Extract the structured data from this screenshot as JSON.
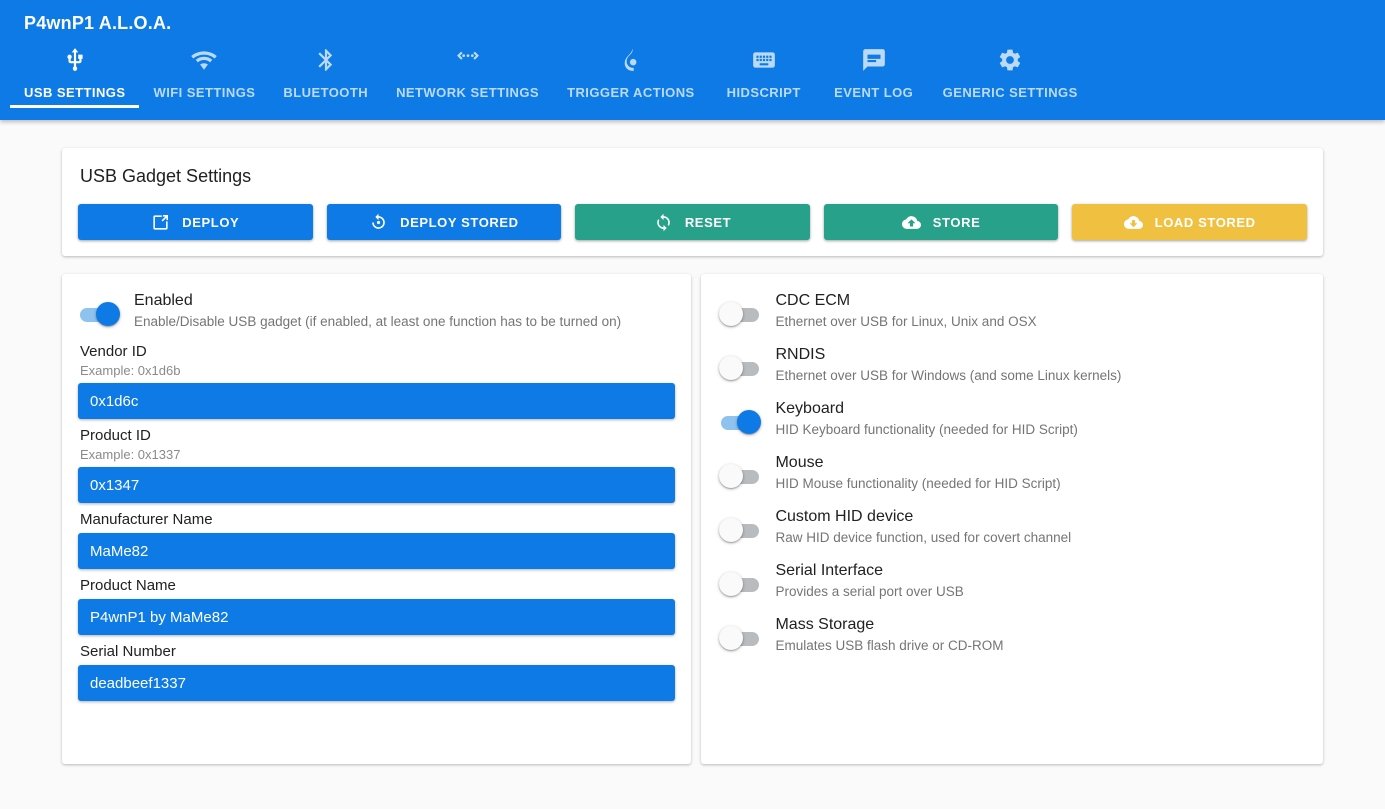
{
  "app": {
    "title": "P4wnP1 A.L.O.A.",
    "header_color": "#0d7ae5"
  },
  "tabs": [
    {
      "label": "USB SETTINGS",
      "icon": "usb-icon",
      "active": true
    },
    {
      "label": "WIFI SETTINGS",
      "icon": "wifi-icon",
      "active": false
    },
    {
      "label": "BLUETOOTH",
      "icon": "bluetooth-icon",
      "active": false
    },
    {
      "label": "NETWORK SETTINGS",
      "icon": "network-icon",
      "active": false
    },
    {
      "label": "TRIGGER ACTIONS",
      "icon": "flame-icon",
      "active": false
    },
    {
      "label": "HIDSCRIPT",
      "icon": "keyboard-icon",
      "active": false
    },
    {
      "label": "EVENT LOG",
      "icon": "event-log-icon",
      "active": false
    },
    {
      "label": "GENERIC SETTINGS",
      "icon": "gear-icon",
      "active": false
    }
  ],
  "usb_gadget": {
    "title": "USB Gadget Settings",
    "buttons": [
      {
        "label": "DEPLOY",
        "icon": "open-in-new-icon",
        "color": "#0d7ae5"
      },
      {
        "label": "DEPLOY STORED",
        "icon": "restore-icon",
        "color": "#0d7ae5"
      },
      {
        "label": "RESET",
        "icon": "sync-icon",
        "color": "#28a18a"
      },
      {
        "label": "STORE",
        "icon": "cloud-upload-icon",
        "color": "#28a18a"
      },
      {
        "label": "LOAD STORED",
        "icon": "cloud-download-icon",
        "color": "#f0c040"
      }
    ]
  },
  "left_panel": {
    "enabled_toggle": {
      "title": "Enabled",
      "desc": "Enable/Disable USB gadget (if enabled, at least one function has to be turned on)",
      "on": true
    },
    "fields": [
      {
        "label": "Vendor ID",
        "hint": "Example: 0x1d6b",
        "value": "0x1d6c"
      },
      {
        "label": "Product ID",
        "hint": "Example: 0x1337",
        "value": "0x1347"
      },
      {
        "label": "Manufacturer Name",
        "hint": "",
        "value": "MaMe82"
      },
      {
        "label": "Product Name",
        "hint": "",
        "value": "P4wnP1 by MaMe82"
      },
      {
        "label": "Serial Number",
        "hint": "",
        "value": "deadbeef1337"
      }
    ]
  },
  "right_panel": {
    "toggles": [
      {
        "title": "CDC ECM",
        "desc": "Ethernet over USB for Linux, Unix and OSX",
        "on": false
      },
      {
        "title": "RNDIS",
        "desc": "Ethernet over USB for Windows (and some Linux kernels)",
        "on": false
      },
      {
        "title": "Keyboard",
        "desc": "HID Keyboard functionality (needed for HID Script)",
        "on": true
      },
      {
        "title": "Mouse",
        "desc": "HID Mouse functionality (needed for HID Script)",
        "on": false
      },
      {
        "title": "Custom HID device",
        "desc": "Raw HID device function, used for covert channel",
        "on": false
      },
      {
        "title": "Serial Interface",
        "desc": "Provides a serial port over USB",
        "on": false
      },
      {
        "title": "Mass Storage",
        "desc": "Emulates USB flash drive or CD-ROM",
        "on": false
      }
    ]
  }
}
